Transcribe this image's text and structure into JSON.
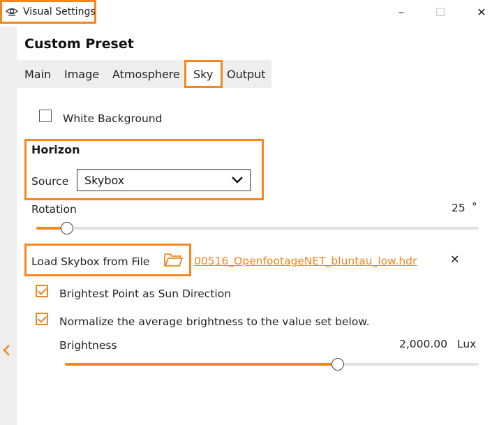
{
  "window": {
    "title": "Visual Settings",
    "minimize": "–",
    "maximize": "☐",
    "close": "✕"
  },
  "preset_title": "Custom Preset",
  "tabs": [
    "Main",
    "Image",
    "Atmosphere",
    "Sky",
    "Output"
  ],
  "active_tab": "Sky",
  "white_background": {
    "label": "White Background",
    "checked": false
  },
  "horizon": {
    "heading": "Horizon",
    "source_label": "Source",
    "source_value": "Skybox"
  },
  "rotation": {
    "label": "Rotation",
    "value": "25",
    "unit": "°",
    "fraction": 0.07
  },
  "skybox_file": {
    "load_label": "Load Skybox from File",
    "filename": "00516_OpenfootageNET_bluntau_low.hdr",
    "clear": "✕"
  },
  "brightest_point": {
    "label": "Brightest Point as Sun Direction",
    "checked": true
  },
  "normalize": {
    "label": "Normalize the average brightness to the value set below.",
    "checked": true
  },
  "brightness": {
    "label": "Brightness",
    "value": "2,000.00",
    "unit": "Lux",
    "fraction": 0.66
  },
  "colors": {
    "accent": "#f0861e",
    "highlight_border": "#f7861e"
  }
}
